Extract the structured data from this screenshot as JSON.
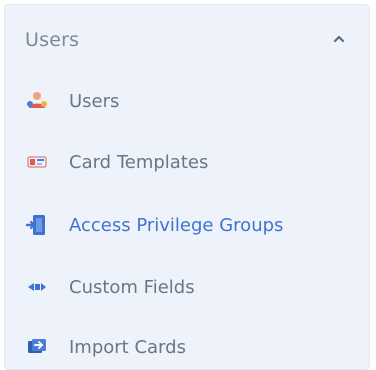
{
  "section": {
    "title": "Users",
    "expanded": true,
    "chevron_icon": "chevron-up-icon"
  },
  "items": [
    {
      "label": "Users",
      "icon": "users-icon",
      "active": false
    },
    {
      "label": "Card Templates",
      "icon": "card-template-icon",
      "active": false
    },
    {
      "label": "Access Privilege Groups",
      "icon": "access-door-icon",
      "active": true
    },
    {
      "label": "Custom Fields",
      "icon": "custom-fields-icon",
      "active": false
    },
    {
      "label": "Import Cards",
      "icon": "import-cards-icon",
      "active": false
    }
  ],
  "colors": {
    "panel_bg": "#eef3fb",
    "text": "#6b7584",
    "active_text": "#3f73d0",
    "header_text": "#7e8895"
  }
}
